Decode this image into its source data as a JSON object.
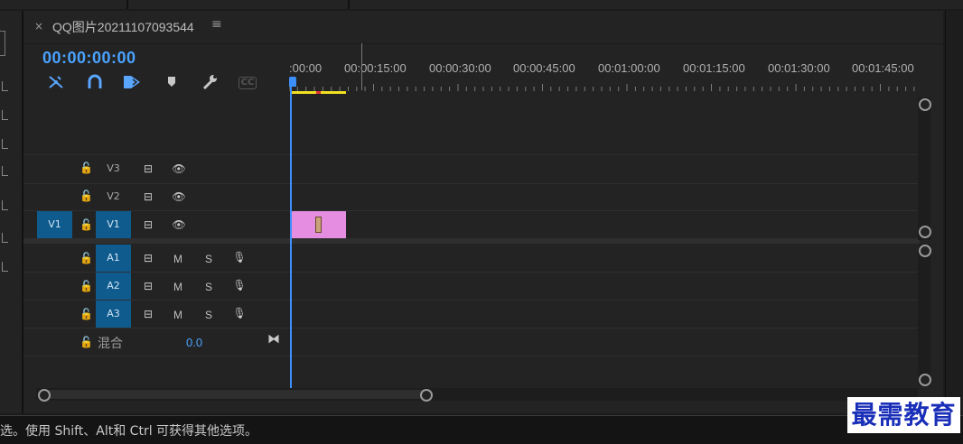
{
  "colors": {
    "accent": "#4aa3ff",
    "track_on": "#0f5b8e",
    "clip": "#e58de0",
    "workarea": "#f0e020",
    "playhead": "#3c8fff"
  },
  "tab": {
    "close": "×",
    "title": "QQ图片20211107093544",
    "menu": "≡"
  },
  "timecode": "00:00:00:00",
  "toolbar": {
    "icons": [
      "snap-icon",
      "linked-selection-icon",
      "insert-overwrite-icon",
      "add-marker-icon",
      "wrench-icon",
      "captions-icon"
    ],
    "captions_label": "CC"
  },
  "ruler": {
    "labels": [
      ":00:00",
      "00:00:15:00",
      "00:00:30:00",
      "00:00:45:00",
      "00:01:00:00",
      "00:01:15:00",
      "00:01:30:00",
      "00:01:45:00"
    ]
  },
  "video_tracks": [
    {
      "source": "",
      "name": "V3",
      "targeted": false
    },
    {
      "source": "",
      "name": "V2",
      "targeted": false
    },
    {
      "source": "V1",
      "name": "V1",
      "targeted": true
    }
  ],
  "audio_tracks": [
    {
      "name": "A1",
      "mute": "M",
      "solo": "S"
    },
    {
      "name": "A2",
      "mute": "M",
      "solo": "S"
    },
    {
      "name": "A3",
      "mute": "M",
      "solo": "S"
    }
  ],
  "mix": {
    "label": "混合",
    "value": "0.0"
  },
  "status_text": "选。使用 Shift、Alt和 Ctrl 可获得其他选项。",
  "watermark": "最需教育"
}
